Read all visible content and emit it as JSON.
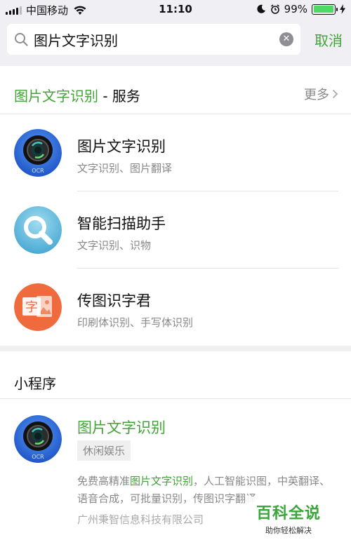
{
  "status_bar": {
    "carrier": "中国移动",
    "time": "11:10",
    "battery": "99%",
    "battery_level": 0.99
  },
  "search": {
    "query": "图片文字识别",
    "cancel_label": "取消"
  },
  "services": {
    "title_highlight": "图片文字识别",
    "title_suffix": " - 服务",
    "more_label": "更多",
    "items": [
      {
        "title": "图片文字识别",
        "subtitle": "文字识别、图片翻译",
        "icon": "ocr-camera-icon"
      },
      {
        "title": "智能扫描助手",
        "subtitle": "文字识别、识物",
        "icon": "magnifier-icon"
      },
      {
        "title": "传图识字君",
        "subtitle": "印刷体识别、手写体识别",
        "icon": "character-image-icon"
      }
    ]
  },
  "mini_programs": {
    "title": "小程序",
    "item": {
      "name": "图片文字识别",
      "tag": "休闲娱乐",
      "desc_pre": "免费高精准",
      "desc_highlight": "图片文字识别",
      "desc_post": "，人工智能识图，中英翻译、语音合成，可批量识别，传图识字翻译",
      "company": "广州秉智信息科技有限公司"
    }
  },
  "watermark": {
    "title": "百科全说",
    "subtitle": "助你轻松解决"
  },
  "colors": {
    "accent": "#3fa535",
    "ocr_icon_bg": "#2e6ee0",
    "magnifier_icon_bg": "#6cc0e0",
    "char_icon_bg": "#f06a3c"
  }
}
